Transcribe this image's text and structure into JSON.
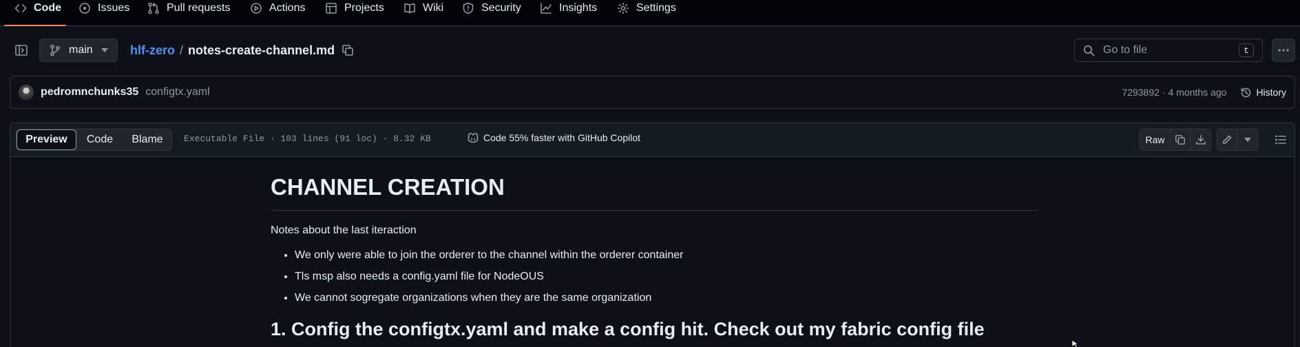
{
  "repo_nav": {
    "items": [
      {
        "label": "Code",
        "icon": "code-icon",
        "active": true
      },
      {
        "label": "Issues",
        "icon": "issue-icon"
      },
      {
        "label": "Pull requests",
        "icon": "pull-request-icon"
      },
      {
        "label": "Actions",
        "icon": "play-icon"
      },
      {
        "label": "Projects",
        "icon": "table-icon"
      },
      {
        "label": "Wiki",
        "icon": "book-icon"
      },
      {
        "label": "Security",
        "icon": "shield-icon"
      },
      {
        "label": "Insights",
        "icon": "graph-icon"
      },
      {
        "label": "Settings",
        "icon": "gear-icon"
      }
    ],
    "accent_color": "#f78166"
  },
  "path_bar": {
    "branch": "main",
    "repo": "hlf-zero",
    "separator": "/",
    "file": "notes-create-channel.md",
    "search_placeholder": "Go to file",
    "search_shortcut": "t"
  },
  "commit": {
    "author": "pedromnchunks35",
    "message": "configtx.yaml",
    "sha": "7293892",
    "dot": "·",
    "time": "4 months ago",
    "history_label": "History"
  },
  "file_header": {
    "tabs": [
      "Preview",
      "Code",
      "Blame"
    ],
    "active_tab": "Preview",
    "info": "Executable File · 103 lines (91 loc) · 8.32 KB",
    "copilot_text": "Code 55% faster with GitHub Copilot",
    "raw_label": "Raw"
  },
  "markdown": {
    "title": "CHANNEL CREATION",
    "intro": "Notes about the last iteraction",
    "bullets": [
      "We only were able to join the orderer to the channel within the orderer container",
      "Tls msp also needs a config.yaml file for NodeOUS",
      "We cannot sogregate organizations when they are the same organization"
    ],
    "next_heading": "1. Config the configtx.yaml  and make a config hit. Check out  my fabric config file"
  },
  "colors": {
    "background": "#0d1117",
    "link": "#4493f8",
    "border": "#30363d",
    "muted_text": "#9198a1"
  }
}
